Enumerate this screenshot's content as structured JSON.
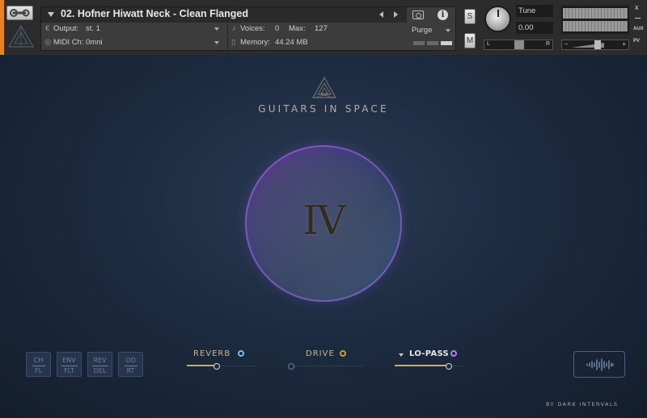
{
  "kontakt": {
    "instrument_title": "02. Hofner Hiwatt Neck - Clean Flanged",
    "output_label": "Output:",
    "output_value": "st. 1",
    "midi_label": "MIDI Ch:",
    "midi_value": "0mni",
    "voices_label": "Voices:",
    "voices_value": "0",
    "max_label": "Max:",
    "max_value": "127",
    "memory_label": "Memory:",
    "memory_value": "44.24 MB",
    "purge_label": "Purge",
    "solo_label": "S",
    "mute_label": "M",
    "tune_label": "Tune",
    "tune_value": "0.00",
    "pan_left": "L",
    "pan_right": "R",
    "vol_minus": "−",
    "vol_plus": "+",
    "aux_label": "AUX",
    "pv_label": "PV",
    "close_glyph": "x"
  },
  "instrument": {
    "brand_name": "GUITARS IN SPACE",
    "volume_numeral": "IV",
    "credit": "BY DARK INTERVALS",
    "mode_buttons": [
      {
        "line1": "CH",
        "line2": "FL"
      },
      {
        "line1": "ENV",
        "line2": "FLT"
      },
      {
        "line1": "REV",
        "line2": "DEL"
      },
      {
        "line1": "OD",
        "line2": "RT"
      }
    ],
    "effects": [
      {
        "label": "REVERB",
        "dot_color": "#6ec3ea",
        "amount": 0.43
      },
      {
        "label": "DRIVE",
        "dot_color": "#c7a23a",
        "amount": 0.0
      },
      {
        "label": "LO-PASS",
        "dot_color": "#b97aee",
        "amount": 0.78
      }
    ]
  },
  "colors": {
    "accent_orange": "#e8821e",
    "orb_purple": "#b545e6",
    "orb_blue": "#3a7ed8",
    "slider_fill": "#c5a97c"
  }
}
